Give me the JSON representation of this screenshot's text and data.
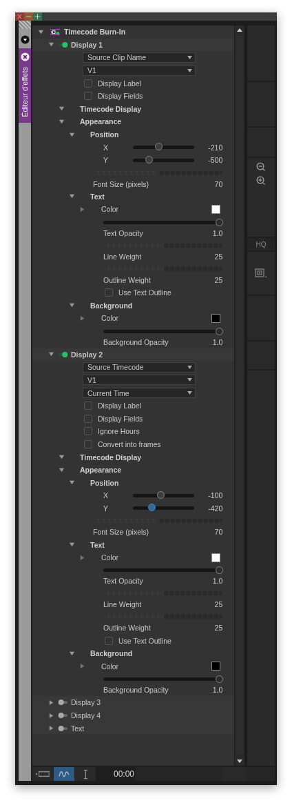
{
  "side_tab": {
    "label": "Éditeur d'effets"
  },
  "tree": {
    "kind": "effect",
    "label": "Timecode Burn-In",
    "expanded": true,
    "children": [
      {
        "kind": "display",
        "label": "Display 1",
        "enabled": true,
        "expanded": true,
        "children": [
          {
            "kind": "dropdown",
            "value": "Source Clip Name"
          },
          {
            "kind": "dropdown",
            "value": "V1"
          },
          {
            "kind": "checkbox",
            "label": "Display Label",
            "checked": false
          },
          {
            "kind": "checkbox",
            "label": "Display Fields",
            "checked": false
          },
          {
            "kind": "group",
            "label": "Timecode Display",
            "expanded": true
          },
          {
            "kind": "group",
            "label": "Appearance",
            "expanded": true,
            "children": [
              {
                "kind": "group",
                "label": "Position",
                "expanded": true,
                "children": [
                  {
                    "kind": "slider",
                    "label": "X",
                    "value": "-210",
                    "level": 0.42,
                    "focused": false
                  },
                  {
                    "kind": "slider",
                    "label": "Y",
                    "value": "-500",
                    "level": 0.26,
                    "focused": false
                  }
                ]
              },
              {
                "kind": "ruler",
                "label": "Font Size (pixels)",
                "value": "70",
                "level": 0.5
              },
              {
                "kind": "group",
                "label": "Text",
                "expanded": true,
                "children": [
                  {
                    "kind": "color",
                    "label": "Color",
                    "color": "#ffffff",
                    "expanded": false
                  },
                  {
                    "kind": "fader",
                    "label": "Text Opacity",
                    "value": "1.0",
                    "level": 1
                  },
                  {
                    "kind": "ruler",
                    "label": "Line Weight",
                    "value": "25",
                    "level": 0.5
                  },
                  {
                    "kind": "ruler",
                    "label": "Outline Weight",
                    "value": "25",
                    "level": 0.5
                  },
                  {
                    "kind": "checkbox",
                    "label": "Use Text Outline",
                    "checked": false
                  }
                ]
              },
              {
                "kind": "group",
                "label": "Background",
                "expanded": true,
                "children": [
                  {
                    "kind": "color",
                    "label": "Color",
                    "color": "#000000",
                    "expanded": false
                  },
                  {
                    "kind": "fader",
                    "label": "Background Opacity",
                    "value": "1.0",
                    "level": 1
                  }
                ]
              }
            ]
          }
        ]
      },
      {
        "kind": "display",
        "label": "Display 2",
        "enabled": true,
        "expanded": true,
        "children": [
          {
            "kind": "dropdown",
            "value": "Source Timecode"
          },
          {
            "kind": "dropdown",
            "value": "V1"
          },
          {
            "kind": "dropdown",
            "value": "Current Time"
          },
          {
            "kind": "checkbox",
            "label": "Display Label",
            "checked": false
          },
          {
            "kind": "checkbox",
            "label": "Display Fields",
            "checked": false
          },
          {
            "kind": "checkbox",
            "label": "Ignore Hours",
            "checked": false
          },
          {
            "kind": "checkbox",
            "label": "Convert into frames",
            "checked": false
          },
          {
            "kind": "group",
            "label": "Timecode Display",
            "expanded": true
          },
          {
            "kind": "group",
            "label": "Appearance",
            "expanded": true,
            "children": [
              {
                "kind": "group",
                "label": "Position",
                "expanded": true,
                "children": [
                  {
                    "kind": "slider",
                    "label": "X",
                    "value": "-100",
                    "level": 0.45,
                    "focused": false
                  },
                  {
                    "kind": "slider",
                    "label": "Y",
                    "value": "-420",
                    "level": 0.3,
                    "focused": true
                  }
                ]
              },
              {
                "kind": "ruler",
                "label": "Font Size (pixels)",
                "value": "70",
                "level": 0.5
              },
              {
                "kind": "group",
                "label": "Text",
                "expanded": true,
                "children": [
                  {
                    "kind": "color",
                    "label": "Color",
                    "color": "#ffffff",
                    "expanded": false
                  },
                  {
                    "kind": "fader",
                    "label": "Text Opacity",
                    "value": "1.0",
                    "level": 1
                  },
                  {
                    "kind": "ruler",
                    "label": "Line Weight",
                    "value": "25",
                    "level": 0.5
                  },
                  {
                    "kind": "ruler",
                    "label": "Outline Weight",
                    "value": "25",
                    "level": 0.5
                  },
                  {
                    "kind": "checkbox",
                    "label": "Use Text Outline",
                    "checked": false
                  }
                ]
              },
              {
                "kind": "group",
                "label": "Background",
                "expanded": true,
                "children": [
                  {
                    "kind": "color",
                    "label": "Color",
                    "color": "#000000",
                    "expanded": false
                  },
                  {
                    "kind": "fader",
                    "label": "Background Opacity",
                    "value": "1.0",
                    "level": 1
                  }
                ]
              }
            ]
          }
        ]
      },
      {
        "kind": "display",
        "label": "Display 3",
        "enabled": false,
        "expanded": false
      },
      {
        "kind": "display",
        "label": "Display 4",
        "enabled": false,
        "expanded": false
      },
      {
        "kind": "display",
        "label": "Text",
        "enabled": false,
        "expanded": false
      }
    ]
  },
  "toolbar": {
    "hq_label": "HQ"
  },
  "bottom_bar": {
    "tools": [
      {
        "kind": "film",
        "selected": false
      },
      {
        "kind": "wave",
        "selected": true
      },
      {
        "kind": "ibeam",
        "selected": false
      }
    ],
    "timecode": "00:00"
  }
}
